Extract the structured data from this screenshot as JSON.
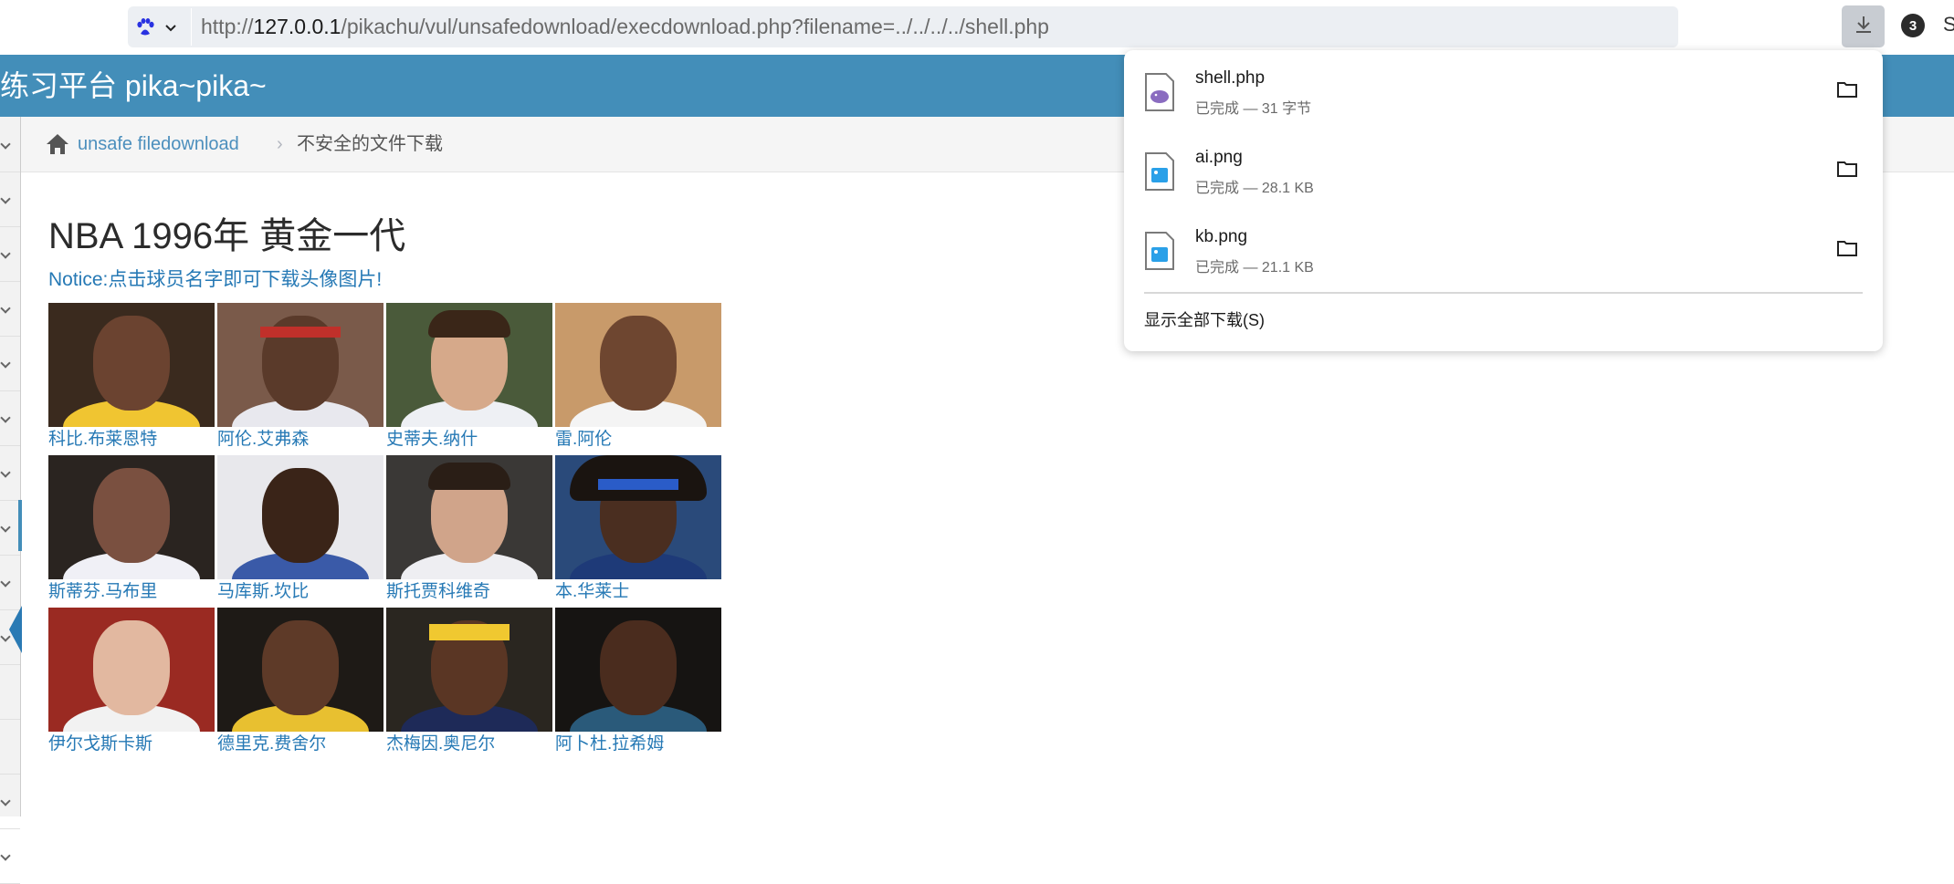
{
  "browser": {
    "url_prefix": "http://",
    "url_host": "127.0.0.1",
    "url_path": "/pikachu/vul/unsafedownload/execdownload.php?filename=../../../../shell.php",
    "download_count": "3"
  },
  "navbar": {
    "brand": "练习平台 pika~pika~"
  },
  "breadcrumb": {
    "link": "unsafe filedownload",
    "separator": "›",
    "current": "不安全的文件下载"
  },
  "main": {
    "title": "NBA 1996年 黄金一代",
    "notice": "Notice:点击球员名字即可下载头像图片!",
    "players": [
      {
        "name": "科比.布莱恩特"
      },
      {
        "name": "阿伦.艾弗森"
      },
      {
        "name": "史蒂夫.纳什"
      },
      {
        "name": "雷.阿伦"
      },
      {
        "name": "斯蒂芬.马布里"
      },
      {
        "name": "马库斯.坎比"
      },
      {
        "name": "斯托贾科维奇"
      },
      {
        "name": "本.华莱士"
      },
      {
        "name": "伊尔戈斯卡斯"
      },
      {
        "name": "德里克.费舍尔"
      },
      {
        "name": "杰梅因.奥尼尔"
      },
      {
        "name": "阿卜杜.拉希姆"
      }
    ]
  },
  "downloads": {
    "items": [
      {
        "name": "shell.php",
        "status": "已完成 — 31 字节",
        "icon": "php-file-icon"
      },
      {
        "name": "ai.png",
        "status": "已完成 — 28.1 KB",
        "icon": "image-file-icon"
      },
      {
        "name": "kb.png",
        "status": "已完成 — 21.1 KB",
        "icon": "image-file-icon"
      }
    ],
    "show_all": "显示全部下载(S)"
  }
}
